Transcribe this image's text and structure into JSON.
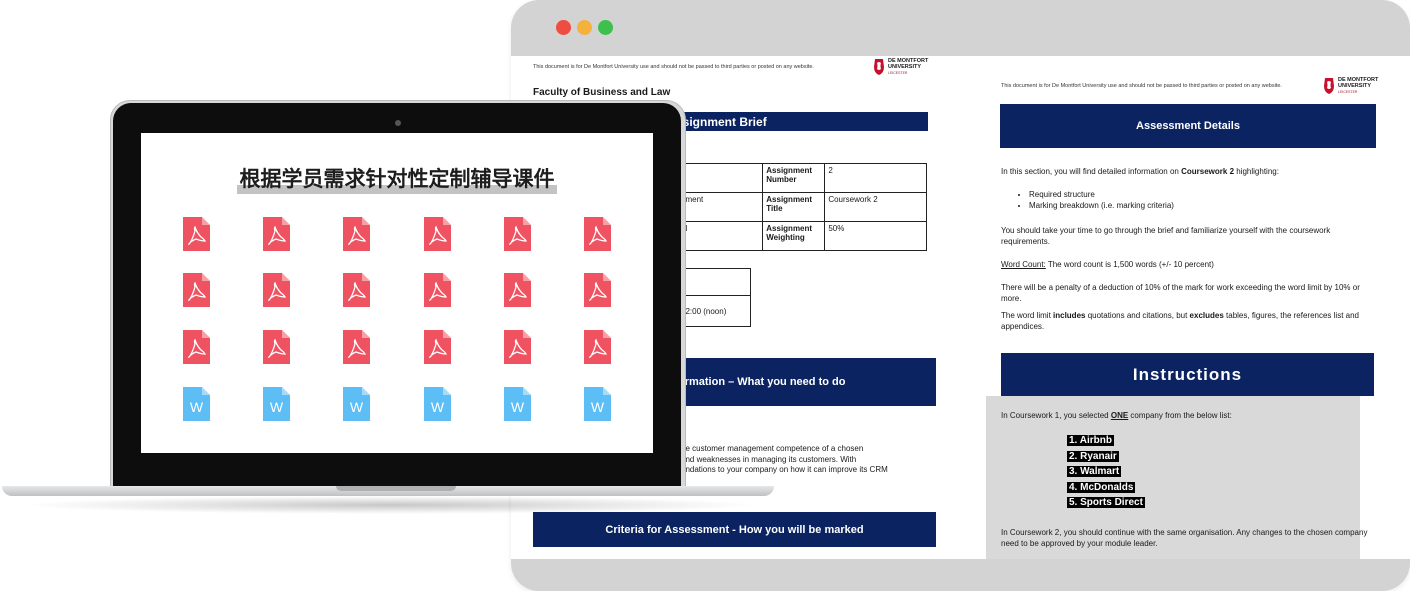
{
  "window_controls": [
    "close",
    "minimize",
    "maximize"
  ],
  "page1": {
    "disclaimer": "This document is for De Montfort University use and should not be passed to third parties or posted on any website.",
    "logo": {
      "line1": "DE MONTFORT",
      "line2": "UNIVERSITY",
      "line3": "LEICESTER"
    },
    "faculty": "Faculty of Business and Law",
    "brief_heading": "ssignment Brief",
    "details_table": [
      {
        "c1": "",
        "c2": "Assignment Number",
        "c3": "2"
      },
      {
        "c1": "ement",
        "c2": "Assignment Title",
        "c3": "Coursework 2"
      },
      {
        "c1": "el",
        "c2": "Assignment Weighting",
        "c3": "50%"
      }
    ],
    "dates_table": [
      {
        "c1": ""
      },
      {
        "c1": "12:00 (noon)"
      }
    ],
    "info_heading": "ormation – What you need to do",
    "info_text": [
      "he customer management competence of a chosen",
      "and weaknesses in managing its customers. With",
      "endations to your company on how it can improve its CRM"
    ],
    "criteria_heading": "Criteria for Assessment - How you will be marked"
  },
  "page2": {
    "disclaimer": "This document is for De Montfort University use and should not be passed to third parties or posted on any website.",
    "logo": {
      "line1": "DE MONTFORT",
      "line2": "UNIVERSITY",
      "line3": "LEICESTER"
    },
    "details_heading": "Assessment Details",
    "intro_pre": "In this section, you will find detailed information on ",
    "intro_bold": "Coursework 2",
    "intro_post": " highlighting:",
    "bullets": [
      "Required structure",
      "Marking breakdown (i.e. marking criteria)"
    ],
    "time_text": "You should take your time to go through the brief and familiarize yourself with the coursework requirements.",
    "word_count_label": "Word Count:",
    "word_count_text": " The word count is 1,500 words (+/- 10 percent)",
    "penalty_text": "There will be a penalty of a deduction of 10% of the mark for work exceeding the word limit by 10% or more.",
    "limit_pre": "The word limit ",
    "limit_includes": "includes",
    "limit_mid": " quotations and citations, but ",
    "limit_excludes": "excludes",
    "limit_post": " tables, figures, the references list and appendices.",
    "instructions_heading": "Instructions",
    "cw1_pre": "In Coursework 1, you selected ",
    "cw1_one": "ONE",
    "cw1_post": " company from the below list:",
    "companies": [
      "1.  Airbnb",
      "2.  Ryanair",
      "3.  Walmart",
      "4.  McDonalds",
      "5.  Sports Direct"
    ],
    "cw2_text": "In Coursework 2, you should continue with the same organisation. Any changes to the chosen company need to be approved by your module leader."
  },
  "laptop": {
    "screen_title": "根据学员需求针对性定制辅导课件",
    "file_icons": {
      "pdf_label": "",
      "word_label": "W",
      "pdf_color": "#ef5361",
      "word_color": "#5dbdf5",
      "rows": [
        [
          "pdf",
          "pdf",
          "pdf",
          "pdf",
          "pdf",
          "pdf"
        ],
        [
          "pdf",
          "pdf",
          "pdf",
          "pdf",
          "pdf",
          "pdf"
        ],
        [
          "pdf",
          "pdf",
          "pdf",
          "pdf",
          "pdf",
          "pdf"
        ],
        [
          "word",
          "word",
          "word",
          "word",
          "word",
          "word"
        ]
      ]
    }
  },
  "colors": {
    "navy": "#0b2461",
    "grey_panel": "#d9d9d9"
  }
}
